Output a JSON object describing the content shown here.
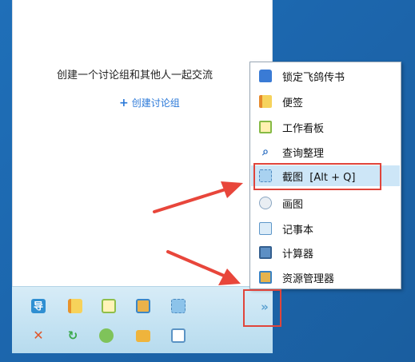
{
  "panel": {
    "empty_text": "创建一个讨论组和其他人一起交流",
    "create_link_icon": "plus-icon",
    "create_link_label": "创建讨论组"
  },
  "toolbar": {
    "row1": [
      {
        "icon": "navigate-icon",
        "glyph": "导"
      },
      {
        "icon": "notes-icon",
        "glyph": ""
      },
      {
        "icon": "whiteboard-icon",
        "glyph": ""
      },
      {
        "icon": "file-manager-icon",
        "glyph": ""
      },
      {
        "icon": "screenshot-icon",
        "glyph": ""
      }
    ],
    "row2": [
      {
        "icon": "tools-icon",
        "glyph": ""
      },
      {
        "icon": "sync-icon",
        "glyph": ""
      },
      {
        "icon": "contacts-icon",
        "glyph": ""
      },
      {
        "icon": "folder-icon",
        "glyph": ""
      },
      {
        "icon": "chat-icon",
        "glyph": ""
      }
    ],
    "expand_label": "»"
  },
  "menu": {
    "items": [
      {
        "label": "锁定飞鸽传书",
        "icon": "lock-icon"
      },
      {
        "label": "便签",
        "icon": "sticky-note-icon"
      },
      {
        "label": "工作看板",
        "icon": "whiteboard-icon"
      },
      {
        "label": "查询整理",
        "icon": "search-icon"
      },
      {
        "label": "截图  [Alt + Q]",
        "icon": "screenshot-icon",
        "selected": true
      },
      {
        "label": "画图",
        "icon": "palette-icon"
      },
      {
        "label": "记事本",
        "icon": "notepad-icon"
      },
      {
        "label": "计算器",
        "icon": "calculator-icon"
      },
      {
        "label": "资源管理器",
        "icon": "explorer-icon"
      }
    ]
  },
  "colors": {
    "desktop": "#1f6fb8",
    "accent": "#2a78d8",
    "highlight": "#cde6f7",
    "annotation": "#e0453b"
  }
}
